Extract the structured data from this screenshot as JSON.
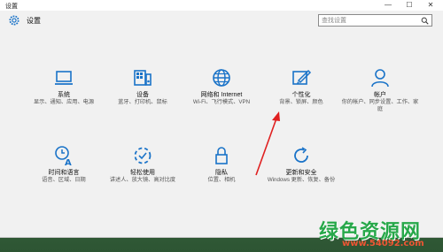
{
  "window": {
    "title": "设置",
    "controls": {
      "minimize": "—",
      "maximize": "☐",
      "close": "✕"
    }
  },
  "header": {
    "title": "设置",
    "icon": "gear-icon",
    "search_placeholder": "查找设置",
    "search_icon": "search-icon"
  },
  "tiles": [
    {
      "icon": "laptop-icon",
      "title": "系统",
      "subtitle": "显示、通知、应用、电源"
    },
    {
      "icon": "devices-icon",
      "title": "设备",
      "subtitle": "蓝牙、打印机、鼠标"
    },
    {
      "icon": "globe-icon",
      "title": "网络和 Internet",
      "subtitle": "Wi-Fi、飞行模式、VPN"
    },
    {
      "icon": "paint-icon",
      "title": "个性化",
      "subtitle": "背景、锁屏、颜色"
    },
    {
      "icon": "person-icon",
      "title": "帐户",
      "subtitle": "你的帐户、同步设置、工作、家庭"
    },
    {
      "icon": "time-language-icon",
      "title": "时间和语言",
      "subtitle": "语音、区域、日期"
    },
    {
      "icon": "ease-of-access-icon",
      "title": "轻松使用",
      "subtitle": "讲述人、放大镜、高对比度"
    },
    {
      "icon": "lock-icon",
      "title": "隐私",
      "subtitle": "位置、相机"
    },
    {
      "icon": "update-icon",
      "title": "更新和安全",
      "subtitle": "Windows 更新、恢复、备份"
    }
  ],
  "watermark": {
    "text": "绿色资源网",
    "url": "www.54092.com"
  },
  "colors": {
    "accent": "#1a73c8",
    "annotation_arrow": "#e02020",
    "window_bg": "#f1f1f1"
  }
}
